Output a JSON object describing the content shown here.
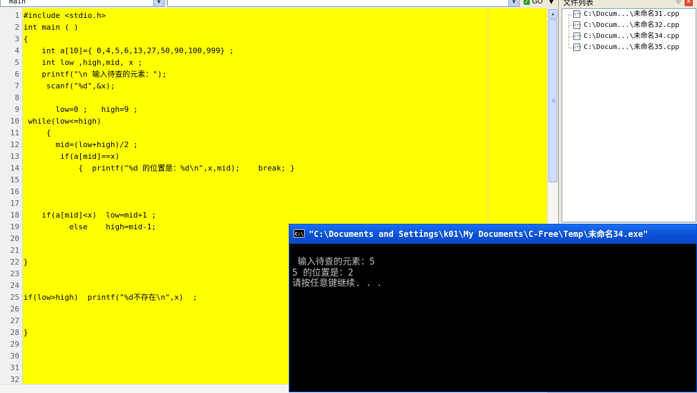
{
  "toolbar": {
    "function_combo_value": "main",
    "search_combo_value": "",
    "go_label": "GO"
  },
  "editor": {
    "line_numbers": [
      "1",
      "2",
      "3",
      "4",
      "5",
      "6",
      "7",
      "8",
      "9",
      "10",
      "11",
      "12",
      "13",
      "14",
      "15",
      "16",
      "17",
      "18",
      "19",
      "20",
      "21",
      "22",
      "23",
      "24",
      "25",
      "26",
      "27",
      "28",
      "29",
      "30",
      "31",
      "32"
    ],
    "lines": [
      "#include <stdio.h>",
      "int main ( )",
      "{",
      "    int a[10]={ 0,4,5,6,13,27,50,90,100,999} ;",
      "    int low ,high,mid, x ;",
      "    printf(\"\\n 输入待查的元素：\");",
      "     scanf(\"%d\",&x);",
      "",
      "       low=0 ;   high=9 ;",
      " while(low<=high)",
      "     {",
      "       mid=(low+high)/2 ;",
      "        if(a[mid]==x)",
      "            {  printf(\"%d 的位置是：%d\\n\",x,mid);    break; }",
      "",
      "",
      "",
      "    if(a[mid]<x)  low=mid+1 ;",
      "          else    high=mid-1;",
      "",
      "",
      "}",
      "",
      "",
      "if(low>high)  printf(\"%d不存在\\n\",x)  ;",
      "",
      "",
      "}",
      "",
      "",
      "",
      ""
    ]
  },
  "file_panel": {
    "title": "文件列表",
    "files": [
      "C:\\Docum...\\未命名31.cpp",
      "C:\\Docum...\\未命名32.cpp",
      "C:\\Docum...\\未命名34.cpp",
      "C:\\Docum...\\未命名35.cpp"
    ]
  },
  "console": {
    "title": "\"C:\\Documents and Settings\\k01\\My Documents\\C-Free\\Temp\\未命名34.exe\"",
    "output_lines": [
      "",
      " 输入待查的元素：5",
      "5 的位置是：2",
      "请按任意键继续. . ."
    ]
  }
}
